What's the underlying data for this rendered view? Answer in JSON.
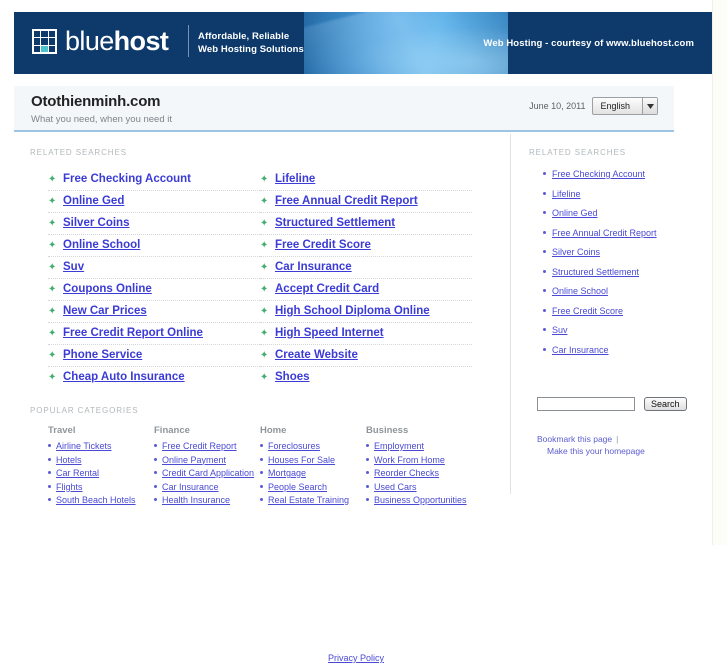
{
  "header": {
    "logo_text_light": "blue",
    "logo_text_bold": "host",
    "tagline_line1": "Affordable, Reliable",
    "tagline_line2": "Web Hosting Solutions",
    "courtesy": "Web Hosting - courtesy of www.bluehost.com",
    "brand_color": "#0d3a6b",
    "accent_color": "#4ec3c9"
  },
  "title_band": {
    "site_title": "Otothienminh.com",
    "site_subtitle": "What you need, when you need it",
    "date": "June 10, 2011",
    "language_selected": "English",
    "language_options": [
      "English"
    ]
  },
  "main": {
    "related_searches_label": "RELATED SEARCHES",
    "related_searches_col1": [
      "Free Checking Account",
      "Online Ged",
      "Silver Coins",
      "Online School",
      "Suv",
      "Coupons Online",
      "New Car Prices",
      "Free Credit Report Online",
      "Phone Service",
      "Cheap Auto Insurance"
    ],
    "related_searches_col2": [
      "Lifeline",
      "Free Annual Credit Report",
      "Structured Settlement",
      "Free Credit Score",
      "Car Insurance",
      "Accept Credit Card",
      "High School Diploma Online",
      "High Speed Internet",
      "Create Website",
      "Shoes"
    ],
    "popular_categories_label": "POPULAR CATEGORIES",
    "categories": [
      {
        "title": "Travel",
        "items": [
          "Airline Tickets",
          "Hotels",
          "Car Rental",
          "Flights",
          "South Beach Hotels"
        ]
      },
      {
        "title": "Finance",
        "items": [
          "Free Credit Report",
          "Online Payment",
          "Credit Card Application",
          "Car Insurance",
          "Health Insurance"
        ]
      },
      {
        "title": "Home",
        "items": [
          "Foreclosures",
          "Houses For Sale",
          "Mortgage",
          "People Search",
          "Real Estate Training"
        ]
      },
      {
        "title": "Business",
        "items": [
          "Employment",
          "Work From Home",
          "Reorder Checks",
          "Used Cars",
          "Business Opportunities"
        ]
      }
    ]
  },
  "sidebar": {
    "related_searches_label": "RELATED SEARCHES",
    "items": [
      "Free Checking Account",
      "Lifeline",
      "Online Ged",
      "Free Annual Credit Report",
      "Silver Coins",
      "Structured Settlement",
      "Online School",
      "Free Credit Score",
      "Suv",
      "Car Insurance"
    ],
    "search_value": "",
    "search_placeholder": "",
    "search_button": "Search",
    "bookmark_link": "Bookmark this page",
    "bookmark_separator": "|",
    "homepage_link": "Make this your homepage"
  },
  "footer": {
    "privacy_policy": "Privacy Policy"
  }
}
